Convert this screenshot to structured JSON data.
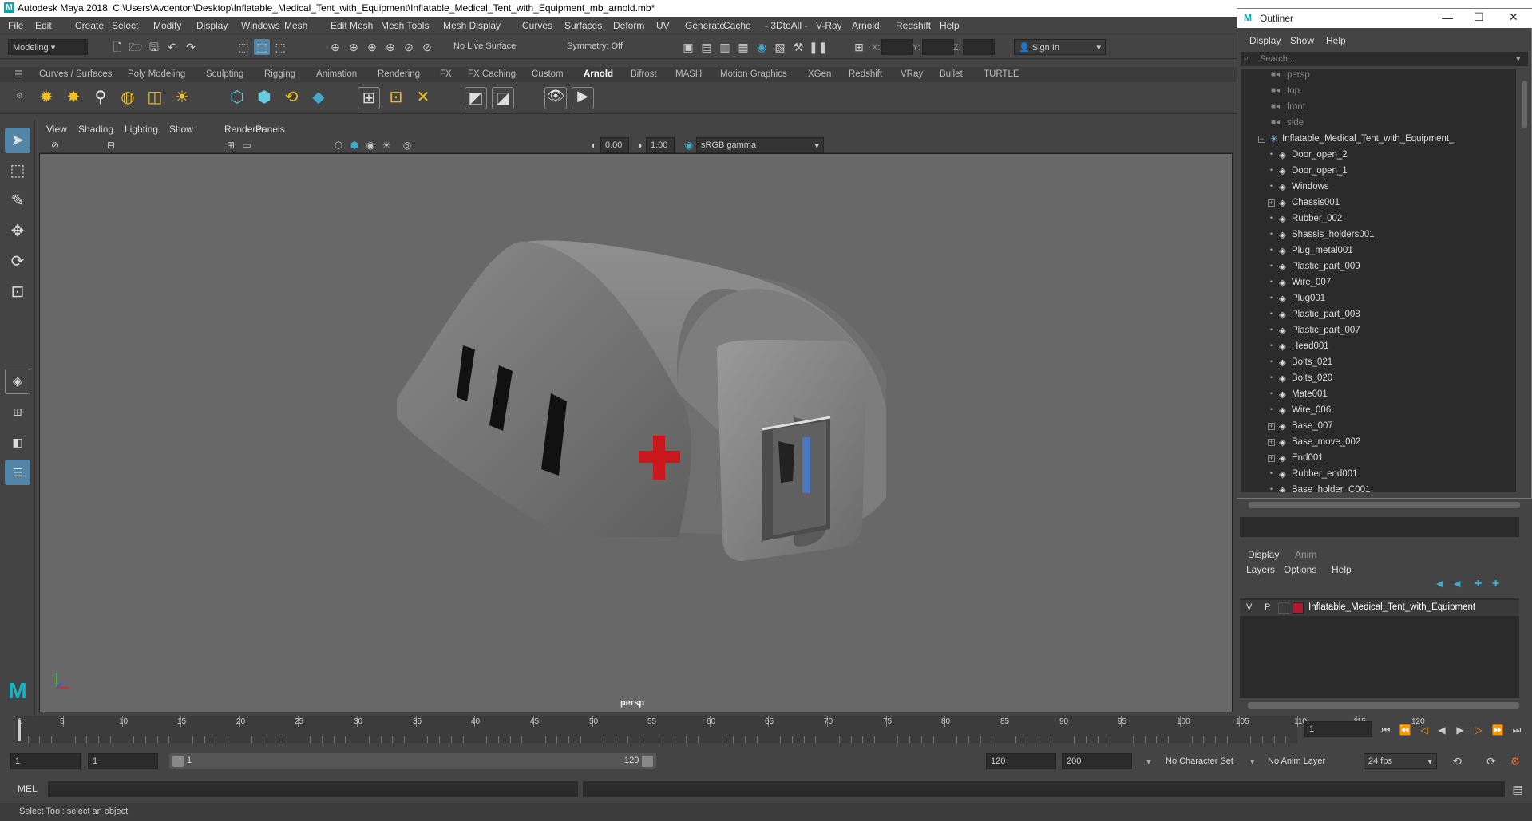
{
  "window": {
    "title": "Autodesk Maya 2018: C:\\Users\\Avdenton\\Desktop\\Inflatable_Medical_Tent_with_Equipment\\Inflatable_Medical_Tent_with_Equipment_mb_arnold.mb*"
  },
  "menu": [
    "File",
    "Edit",
    "Create",
    "Select",
    "Modify",
    "Display",
    "Windows",
    "Mesh",
    "Edit Mesh",
    "Mesh Tools",
    "Mesh Display",
    "Curves",
    "Surfaces",
    "Deform",
    "UV",
    "Generate",
    "Cache",
    "- 3DtoAll -",
    "V-Ray",
    "Arnold",
    "Redshift",
    "Help"
  ],
  "status": {
    "mode": "Modeling",
    "live_surface": "No Live Surface",
    "symmetry": "Symmetry: Off",
    "x_label": "X:",
    "y_label": "Y:",
    "z_label": "Z:",
    "sign_in": "Sign In"
  },
  "shelf_tabs": [
    "Curves / Surfaces",
    "Poly Modeling",
    "Sculpting",
    "Rigging",
    "Animation",
    "Rendering",
    "FX",
    "FX Caching",
    "Custom",
    "Arnold",
    "Bifrost",
    "MASH",
    "Motion Graphics",
    "XGen",
    "Redshift",
    "VRay",
    "Bullet",
    "TURTLE"
  ],
  "active_shelf": "Arnold",
  "viewport": {
    "menu": [
      "View",
      "Shading",
      "Lighting",
      "Show",
      "Renderer",
      "Panels"
    ],
    "exposure": "0.00",
    "gamma": "1.00",
    "color_space": "sRGB gamma",
    "camera_label": "persp"
  },
  "outliner": {
    "title": "Outliner",
    "menu": [
      "Display",
      "Show",
      "Help"
    ],
    "search_placeholder": "Search...",
    "cameras": [
      "persp",
      "top",
      "front",
      "side"
    ],
    "root": "Inflatable_Medical_Tent_with_Equipment_",
    "items": [
      "Door_open_2",
      "Door_open_1",
      "Windows",
      "Chassis001",
      "Rubber_002",
      "Shassis_holders001",
      "Plug_metal001",
      "Plastic_part_009",
      "Wire_007",
      "Plug001",
      "Plastic_part_008",
      "Plastic_part_007",
      "Head001",
      "Bolts_021",
      "Bolts_020",
      "Mate001",
      "Wire_006",
      "Base_007",
      "Base_move_002",
      "End001",
      "Rubber_end001",
      "Base_holder_C001"
    ]
  },
  "layers": {
    "tabs": [
      "Display",
      "Anim"
    ],
    "menu": [
      "Layers",
      "Options",
      "Help"
    ],
    "v": "V",
    "p": "P",
    "layer_name": "Inflatable_Medical_Tent_with_Equipment",
    "layer_color": "#b01830"
  },
  "timeline": {
    "ticks": [
      "5",
      "10",
      "15",
      "20",
      "25",
      "30",
      "35",
      "40",
      "45",
      "50",
      "55",
      "60",
      "65",
      "70",
      "75",
      "80",
      "85",
      "90",
      "95",
      "100",
      "105",
      "110",
      "115",
      "120"
    ],
    "start_tick": "1",
    "current_frame": "1"
  },
  "range": {
    "start": "1",
    "anim_start": "1",
    "slider_start": "1",
    "slider_end": "120",
    "end": "120",
    "anim_end": "200",
    "char_set": "No Character Set",
    "anim_layer": "No Anim Layer",
    "fps": "24 fps"
  },
  "cmd": {
    "label": "MEL"
  },
  "help": {
    "text": "Select Tool: select an object"
  }
}
